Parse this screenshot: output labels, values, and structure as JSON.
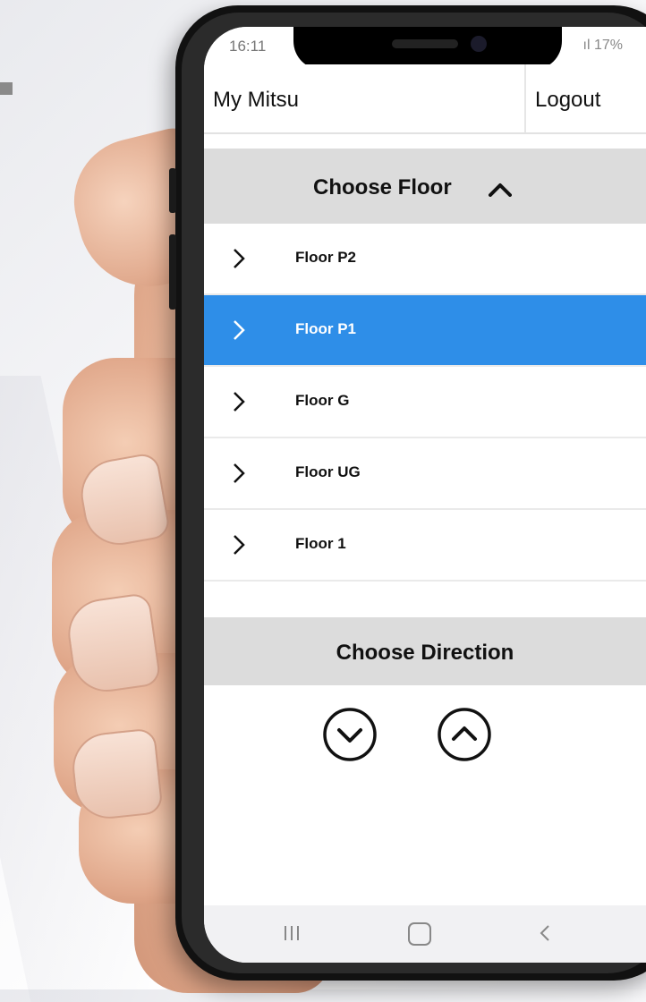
{
  "status_bar": {
    "time": "16:11",
    "right": "ıl 17%"
  },
  "app_bar": {
    "title": "My Mitsu",
    "logout_label": "Logout"
  },
  "floor_section": {
    "header": "Choose Floor",
    "items": [
      {
        "label": "Floor P2",
        "selected": false
      },
      {
        "label": "Floor P1",
        "selected": true
      },
      {
        "label": "Floor G",
        "selected": false
      },
      {
        "label": "Floor UG",
        "selected": false
      },
      {
        "label": "Floor 1",
        "selected": false
      }
    ]
  },
  "direction_section": {
    "header": "Choose Direction"
  },
  "icons": {
    "floor_header_toggle": "chevron-up-icon",
    "floor_item": "chevron-right-icon",
    "direction_down": "circle-chevron-down-icon",
    "direction_up": "circle-chevron-up-icon",
    "nav_recent": "recent-apps-icon",
    "nav_home": "home-icon",
    "nav_back": "back-icon"
  },
  "colors": {
    "selected": "#2e8ee8",
    "section_header_bg": "#dcdcdc",
    "screen_bg": "#ffffff"
  }
}
